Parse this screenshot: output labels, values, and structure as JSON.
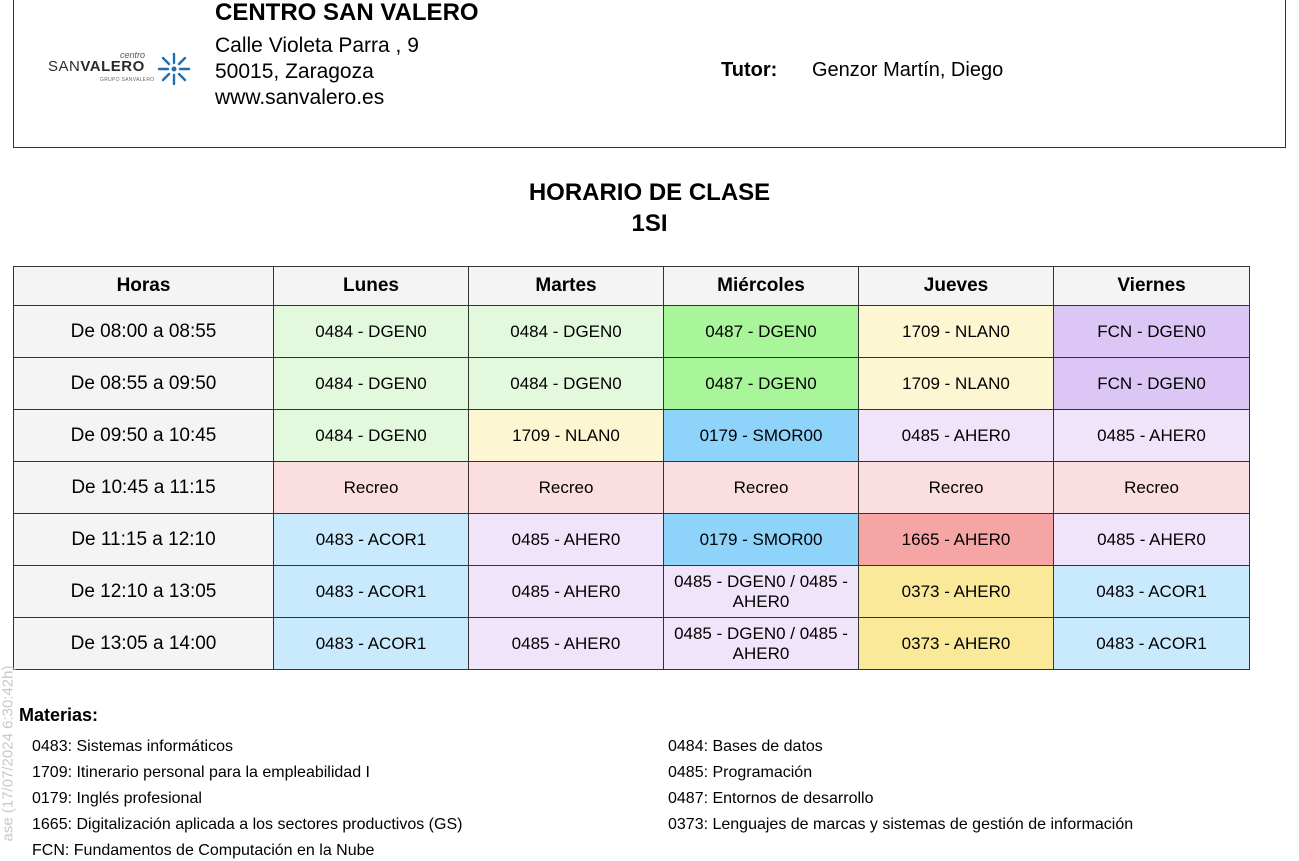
{
  "header": {
    "logo": {
      "top_word": "centro",
      "brand_light": "SAN",
      "brand_bold": "VALERO",
      "tagline": "GRUPO SANVALERO",
      "icon": "compass-star-icon"
    },
    "center_name": "CENTRO SAN VALERO",
    "address_line1": "Calle Violeta Parra ,  9",
    "address_line2": "50015, Zaragoza",
    "website": "www.sanvalero.es",
    "tutor_label": "Tutor:",
    "tutor_name": "Genzor Martín, Diego"
  },
  "title": "HORARIO DE CLASE",
  "subtitle": "1SI",
  "table": {
    "headers": [
      "Horas",
      "Lunes",
      "Martes",
      "Miércoles",
      "Jueves",
      "Viernes"
    ],
    "rows": [
      {
        "hour": "De 08:00 a 08:55",
        "cells": [
          {
            "text": "0484 - DGEN0",
            "color": "#e2f9dd"
          },
          {
            "text": "0484 - DGEN0",
            "color": "#e2f9dd"
          },
          {
            "text": "0487 - DGEN0",
            "color": "#a9f59a"
          },
          {
            "text": "1709 - NLAN0",
            "color": "#fdf6d3"
          },
          {
            "text": "FCN - DGEN0",
            "color": "#dcc6f5"
          }
        ]
      },
      {
        "hour": "De 08:55 a 09:50",
        "cells": [
          {
            "text": "0484 - DGEN0",
            "color": "#e2f9dd"
          },
          {
            "text": "0484 - DGEN0",
            "color": "#e2f9dd"
          },
          {
            "text": "0487 - DGEN0",
            "color": "#a9f59a"
          },
          {
            "text": "1709 - NLAN0",
            "color": "#fdf6d3"
          },
          {
            "text": "FCN - DGEN0",
            "color": "#dcc6f5"
          }
        ]
      },
      {
        "hour": "De 09:50 a 10:45",
        "cells": [
          {
            "text": "0484 - DGEN0",
            "color": "#e2f9dd"
          },
          {
            "text": "1709 - NLAN0",
            "color": "#fdf6d3"
          },
          {
            "text": "0179 - SMOR00",
            "color": "#8ed3fa"
          },
          {
            "text": "0485 - AHER0",
            "color": "#f0e4fa"
          },
          {
            "text": "0485 - AHER0",
            "color": "#f0e4fa"
          }
        ]
      },
      {
        "hour": "De 10:45 a 11:15",
        "cells": [
          {
            "text": "Recreo",
            "color": "#fbdfe0"
          },
          {
            "text": "Recreo",
            "color": "#fbdfe0"
          },
          {
            "text": "Recreo",
            "color": "#fbdfe0"
          },
          {
            "text": "Recreo",
            "color": "#fbdfe0"
          },
          {
            "text": "Recreo",
            "color": "#fbdfe0"
          }
        ]
      },
      {
        "hour": "De 11:15 a 12:10",
        "cells": [
          {
            "text": "0483 - ACOR1",
            "color": "#c9eafd"
          },
          {
            "text": "0485 - AHER0",
            "color": "#f0e4fa"
          },
          {
            "text": "0179 - SMOR00",
            "color": "#8ed3fa"
          },
          {
            "text": "1665 - AHER0",
            "color": "#f6a5a5"
          },
          {
            "text": "0485 - AHER0",
            "color": "#f0e4fa"
          }
        ]
      },
      {
        "hour": "De 12:10 a 13:05",
        "cells": [
          {
            "text": "0483 - ACOR1",
            "color": "#c9eafd"
          },
          {
            "text": "0485 - AHER0",
            "color": "#f0e4fa"
          },
          {
            "text": "0485 - DGEN0 / 0485 - AHER0",
            "color": "#f0e4fa"
          },
          {
            "text": "0373 - AHER0",
            "color": "#fbe99a"
          },
          {
            "text": "0483 - ACOR1",
            "color": "#c9eafd"
          }
        ]
      },
      {
        "hour": "De 13:05 a 14:00",
        "cells": [
          {
            "text": "0483 - ACOR1",
            "color": "#c9eafd"
          },
          {
            "text": "0485 - AHER0",
            "color": "#f0e4fa"
          },
          {
            "text": "0485 - DGEN0 / 0485 - AHER0",
            "color": "#f0e4fa"
          },
          {
            "text": "0373 - AHER0",
            "color": "#fbe99a"
          },
          {
            "text": "0483 - ACOR1",
            "color": "#c9eafd"
          }
        ]
      }
    ]
  },
  "materias": {
    "title": "Materias:",
    "left": [
      "0483: Sistemas informáticos",
      "1709: Itinerario personal para la empleabilidad I",
      "0179: Inglés profesional",
      "1665: Digitalización aplicada a los sectores productivos (GS)",
      "FCN: Fundamentos de Computación en la Nube"
    ],
    "right": [
      "0484: Bases de datos",
      "0485: Programación",
      "0487: Entornos de desarrollo",
      "0373: Lenguajes de marcas y sistemas de gestión de información"
    ]
  },
  "watermark": "ase (17/07/2024 6:30:42h)"
}
